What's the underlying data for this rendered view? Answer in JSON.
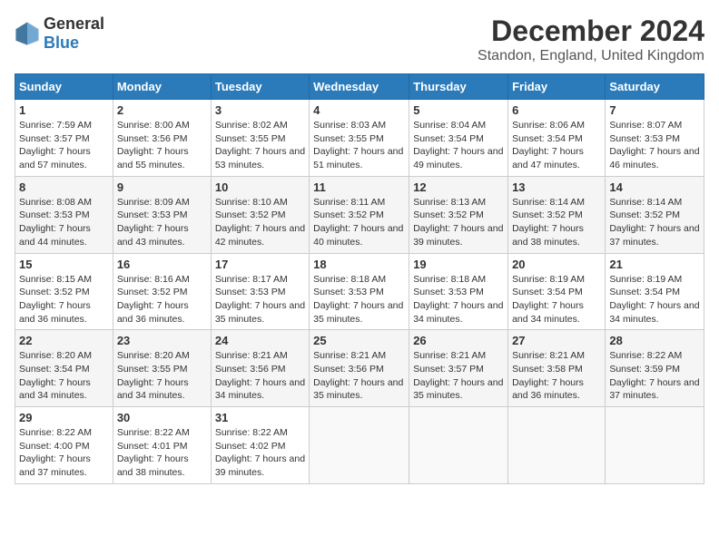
{
  "logo": {
    "general": "General",
    "blue": "Blue"
  },
  "title": "December 2024",
  "subtitle": "Standon, England, United Kingdom",
  "days_header": [
    "Sunday",
    "Monday",
    "Tuesday",
    "Wednesday",
    "Thursday",
    "Friday",
    "Saturday"
  ],
  "weeks": [
    [
      {
        "day": "1",
        "sunrise": "Sunrise: 7:59 AM",
        "sunset": "Sunset: 3:57 PM",
        "daylight": "Daylight: 7 hours and 57 minutes."
      },
      {
        "day": "2",
        "sunrise": "Sunrise: 8:00 AM",
        "sunset": "Sunset: 3:56 PM",
        "daylight": "Daylight: 7 hours and 55 minutes."
      },
      {
        "day": "3",
        "sunrise": "Sunrise: 8:02 AM",
        "sunset": "Sunset: 3:55 PM",
        "daylight": "Daylight: 7 hours and 53 minutes."
      },
      {
        "day": "4",
        "sunrise": "Sunrise: 8:03 AM",
        "sunset": "Sunset: 3:55 PM",
        "daylight": "Daylight: 7 hours and 51 minutes."
      },
      {
        "day": "5",
        "sunrise": "Sunrise: 8:04 AM",
        "sunset": "Sunset: 3:54 PM",
        "daylight": "Daylight: 7 hours and 49 minutes."
      },
      {
        "day": "6",
        "sunrise": "Sunrise: 8:06 AM",
        "sunset": "Sunset: 3:54 PM",
        "daylight": "Daylight: 7 hours and 47 minutes."
      },
      {
        "day": "7",
        "sunrise": "Sunrise: 8:07 AM",
        "sunset": "Sunset: 3:53 PM",
        "daylight": "Daylight: 7 hours and 46 minutes."
      }
    ],
    [
      {
        "day": "8",
        "sunrise": "Sunrise: 8:08 AM",
        "sunset": "Sunset: 3:53 PM",
        "daylight": "Daylight: 7 hours and 44 minutes."
      },
      {
        "day": "9",
        "sunrise": "Sunrise: 8:09 AM",
        "sunset": "Sunset: 3:53 PM",
        "daylight": "Daylight: 7 hours and 43 minutes."
      },
      {
        "day": "10",
        "sunrise": "Sunrise: 8:10 AM",
        "sunset": "Sunset: 3:52 PM",
        "daylight": "Daylight: 7 hours and 42 minutes."
      },
      {
        "day": "11",
        "sunrise": "Sunrise: 8:11 AM",
        "sunset": "Sunset: 3:52 PM",
        "daylight": "Daylight: 7 hours and 40 minutes."
      },
      {
        "day": "12",
        "sunrise": "Sunrise: 8:13 AM",
        "sunset": "Sunset: 3:52 PM",
        "daylight": "Daylight: 7 hours and 39 minutes."
      },
      {
        "day": "13",
        "sunrise": "Sunrise: 8:14 AM",
        "sunset": "Sunset: 3:52 PM",
        "daylight": "Daylight: 7 hours and 38 minutes."
      },
      {
        "day": "14",
        "sunrise": "Sunrise: 8:14 AM",
        "sunset": "Sunset: 3:52 PM",
        "daylight": "Daylight: 7 hours and 37 minutes."
      }
    ],
    [
      {
        "day": "15",
        "sunrise": "Sunrise: 8:15 AM",
        "sunset": "Sunset: 3:52 PM",
        "daylight": "Daylight: 7 hours and 36 minutes."
      },
      {
        "day": "16",
        "sunrise": "Sunrise: 8:16 AM",
        "sunset": "Sunset: 3:52 PM",
        "daylight": "Daylight: 7 hours and 36 minutes."
      },
      {
        "day": "17",
        "sunrise": "Sunrise: 8:17 AM",
        "sunset": "Sunset: 3:53 PM",
        "daylight": "Daylight: 7 hours and 35 minutes."
      },
      {
        "day": "18",
        "sunrise": "Sunrise: 8:18 AM",
        "sunset": "Sunset: 3:53 PM",
        "daylight": "Daylight: 7 hours and 35 minutes."
      },
      {
        "day": "19",
        "sunrise": "Sunrise: 8:18 AM",
        "sunset": "Sunset: 3:53 PM",
        "daylight": "Daylight: 7 hours and 34 minutes."
      },
      {
        "day": "20",
        "sunrise": "Sunrise: 8:19 AM",
        "sunset": "Sunset: 3:54 PM",
        "daylight": "Daylight: 7 hours and 34 minutes."
      },
      {
        "day": "21",
        "sunrise": "Sunrise: 8:19 AM",
        "sunset": "Sunset: 3:54 PM",
        "daylight": "Daylight: 7 hours and 34 minutes."
      }
    ],
    [
      {
        "day": "22",
        "sunrise": "Sunrise: 8:20 AM",
        "sunset": "Sunset: 3:54 PM",
        "daylight": "Daylight: 7 hours and 34 minutes."
      },
      {
        "day": "23",
        "sunrise": "Sunrise: 8:20 AM",
        "sunset": "Sunset: 3:55 PM",
        "daylight": "Daylight: 7 hours and 34 minutes."
      },
      {
        "day": "24",
        "sunrise": "Sunrise: 8:21 AM",
        "sunset": "Sunset: 3:56 PM",
        "daylight": "Daylight: 7 hours and 34 minutes."
      },
      {
        "day": "25",
        "sunrise": "Sunrise: 8:21 AM",
        "sunset": "Sunset: 3:56 PM",
        "daylight": "Daylight: 7 hours and 35 minutes."
      },
      {
        "day": "26",
        "sunrise": "Sunrise: 8:21 AM",
        "sunset": "Sunset: 3:57 PM",
        "daylight": "Daylight: 7 hours and 35 minutes."
      },
      {
        "day": "27",
        "sunrise": "Sunrise: 8:21 AM",
        "sunset": "Sunset: 3:58 PM",
        "daylight": "Daylight: 7 hours and 36 minutes."
      },
      {
        "day": "28",
        "sunrise": "Sunrise: 8:22 AM",
        "sunset": "Sunset: 3:59 PM",
        "daylight": "Daylight: 7 hours and 37 minutes."
      }
    ],
    [
      {
        "day": "29",
        "sunrise": "Sunrise: 8:22 AM",
        "sunset": "Sunset: 4:00 PM",
        "daylight": "Daylight: 7 hours and 37 minutes."
      },
      {
        "day": "30",
        "sunrise": "Sunrise: 8:22 AM",
        "sunset": "Sunset: 4:01 PM",
        "daylight": "Daylight: 7 hours and 38 minutes."
      },
      {
        "day": "31",
        "sunrise": "Sunrise: 8:22 AM",
        "sunset": "Sunset: 4:02 PM",
        "daylight": "Daylight: 7 hours and 39 minutes."
      },
      null,
      null,
      null,
      null
    ]
  ]
}
